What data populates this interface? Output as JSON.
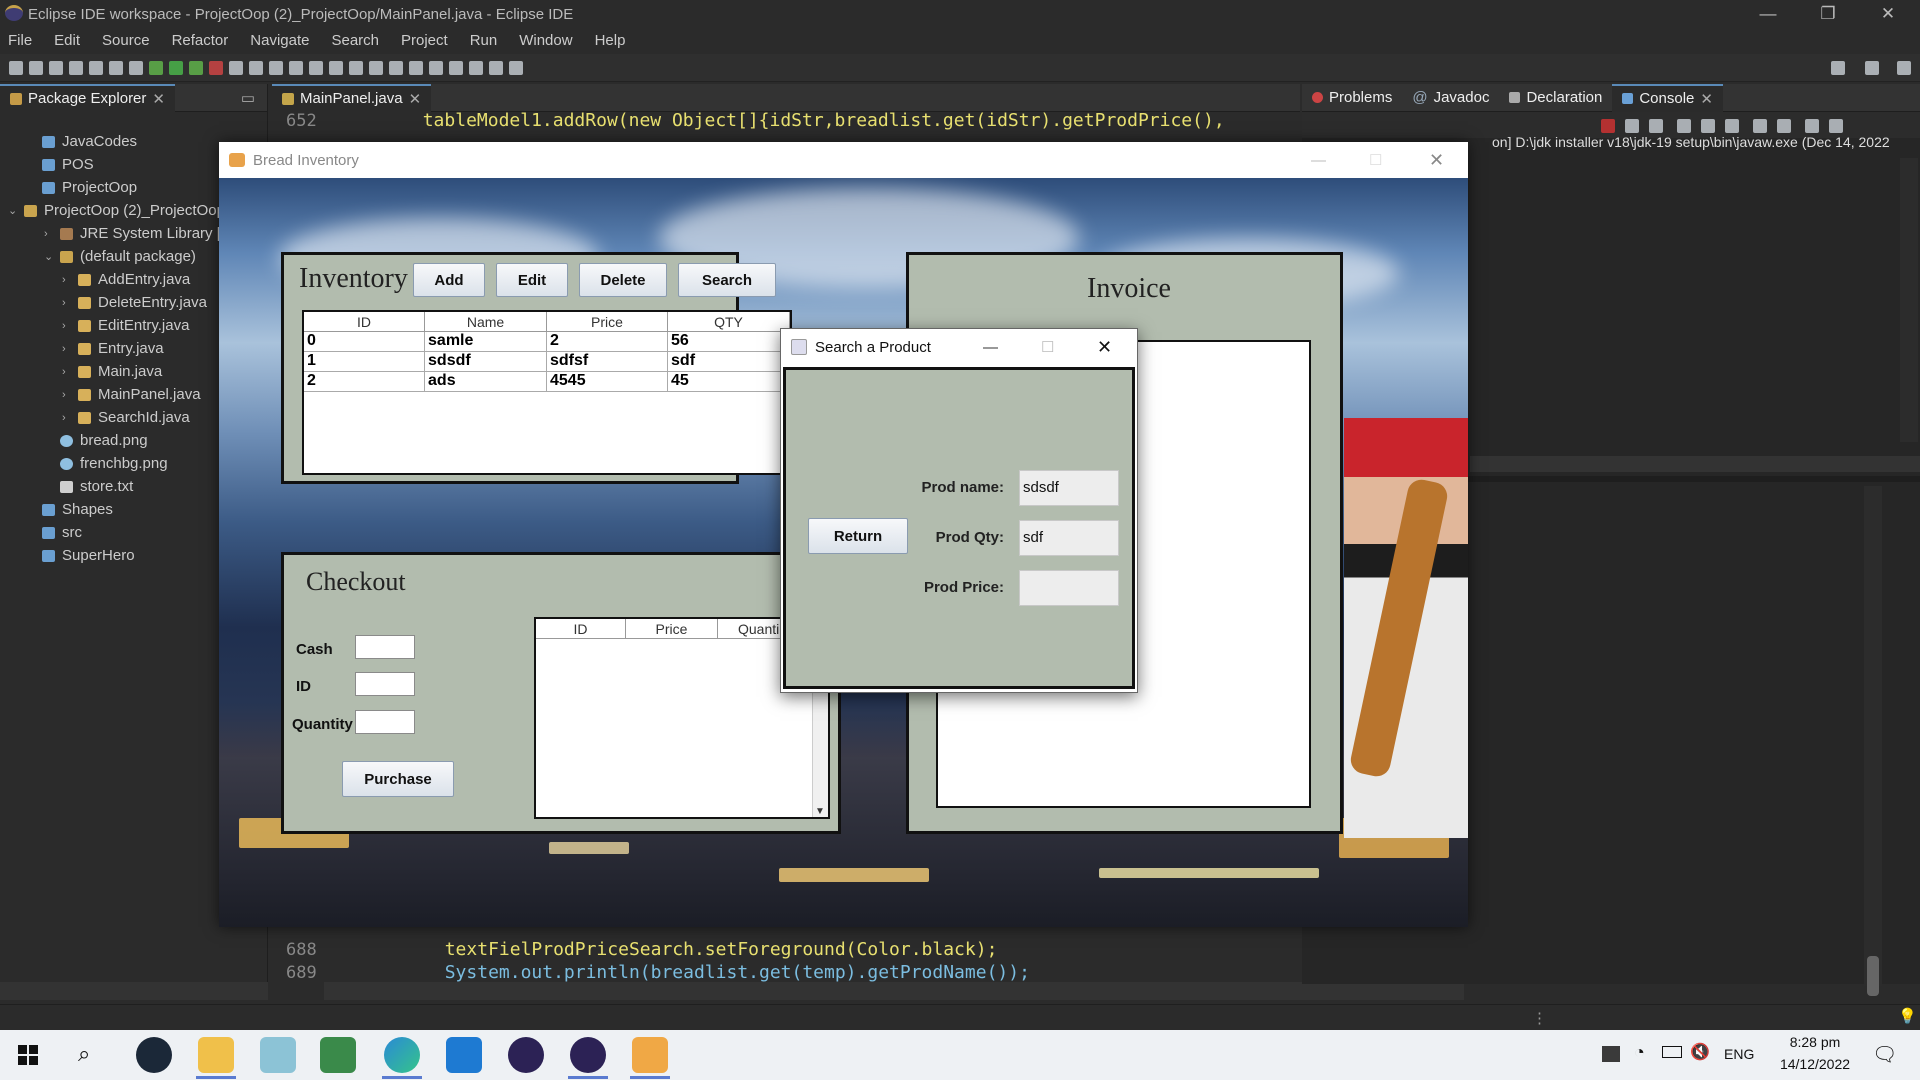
{
  "eclipse": {
    "window_title": "Eclipse IDE workspace - ProjectOop (2)_ProjectOop/MainPanel.java - Eclipse IDE",
    "menus": [
      "File",
      "Edit",
      "Source",
      "Refactor",
      "Navigate",
      "Search",
      "Project",
      "Run",
      "Window",
      "Help"
    ],
    "package_explorer": {
      "tab_label": "Package Explorer",
      "items": [
        {
          "label": "JavaCodes",
          "indent": 1,
          "kind": "project"
        },
        {
          "label": "POS",
          "indent": 1,
          "kind": "project"
        },
        {
          "label": "ProjectOop",
          "indent": 1,
          "kind": "project"
        },
        {
          "label": "ProjectOop (2)_ProjectOop",
          "indent": 0,
          "kind": "project-open"
        },
        {
          "label": "JRE System Library [jdk",
          "indent": 2,
          "kind": "library"
        },
        {
          "label": "(default package)",
          "indent": 2,
          "kind": "package"
        },
        {
          "label": "AddEntry.java",
          "indent": 3,
          "kind": "java"
        },
        {
          "label": "DeleteEntry.java",
          "indent": 3,
          "kind": "java"
        },
        {
          "label": "EditEntry.java",
          "indent": 3,
          "kind": "java"
        },
        {
          "label": "Entry.java",
          "indent": 3,
          "kind": "java"
        },
        {
          "label": "Main.java",
          "indent": 3,
          "kind": "java"
        },
        {
          "label": "MainPanel.java",
          "indent": 3,
          "kind": "java"
        },
        {
          "label": "SearchId.java",
          "indent": 3,
          "kind": "java"
        },
        {
          "label": "bread.png",
          "indent": 2,
          "kind": "image"
        },
        {
          "label": "frenchbg.png",
          "indent": 2,
          "kind": "image"
        },
        {
          "label": "store.txt",
          "indent": 2,
          "kind": "text"
        },
        {
          "label": "Shapes",
          "indent": 1,
          "kind": "project"
        },
        {
          "label": "src",
          "indent": 1,
          "kind": "project"
        },
        {
          "label": "SuperHero",
          "indent": 1,
          "kind": "project"
        }
      ]
    },
    "editor": {
      "tab_label": "MainPanel.java",
      "top_line_no": "652",
      "top_line_code": "tableModel1.addRow(new Object[]{idStr,breadlist.get(idStr).getProdPrice(),",
      "bottom_lines": [
        {
          "no": "688",
          "code": "textFielProdPriceSearch.setForeground(Color.black);"
        },
        {
          "no": "689",
          "code": "System.out.println(breadlist.get(temp).getProdName());"
        }
      ]
    },
    "right_tabs": [
      "Problems",
      "Javadoc",
      "Declaration",
      "Console"
    ],
    "console_line": "on] D:\\jdk installer v18\\jdk-19 setup\\bin\\javaw.exe  (Dec 14, 2022"
  },
  "app": {
    "title": "Bread Inventory",
    "inventory": {
      "heading": "Inventory",
      "buttons": [
        "Add",
        "Edit",
        "Delete",
        "Search"
      ],
      "columns": [
        "ID",
        "Name",
        "Price",
        "QTY"
      ],
      "rows": [
        [
          "0",
          "samle",
          "2",
          "56"
        ],
        [
          "1",
          "sdsdf",
          "sdfsf",
          "sdf"
        ],
        [
          "2",
          "ads",
          "4545",
          "45"
        ]
      ]
    },
    "checkout": {
      "heading": "Checkout",
      "labels": {
        "cash": "Cash",
        "id": "ID",
        "quantity": "Quantity"
      },
      "purchase_label": "Purchase",
      "columns": [
        "ID",
        "Price",
        "Quanti"
      ]
    },
    "invoice": {
      "heading": "Invoice"
    }
  },
  "search_dialog": {
    "title": "Search a Product",
    "return_label": "Return",
    "prod_name_label": "Prod name:",
    "prod_name_value": "sdsdf",
    "prod_qty_label": "Prod Qty:",
    "prod_qty_value": "sdf",
    "prod_price_label": "Prod Price:",
    "prod_price_value": ""
  },
  "taskbar": {
    "language": "ENG",
    "time": "8:28 pm",
    "date": "14/12/2022"
  },
  "colors": {
    "panel_bg": "#b2bcae",
    "ide_bg": "#2b2b2b",
    "taskbar_bg": "#eef1f4"
  }
}
